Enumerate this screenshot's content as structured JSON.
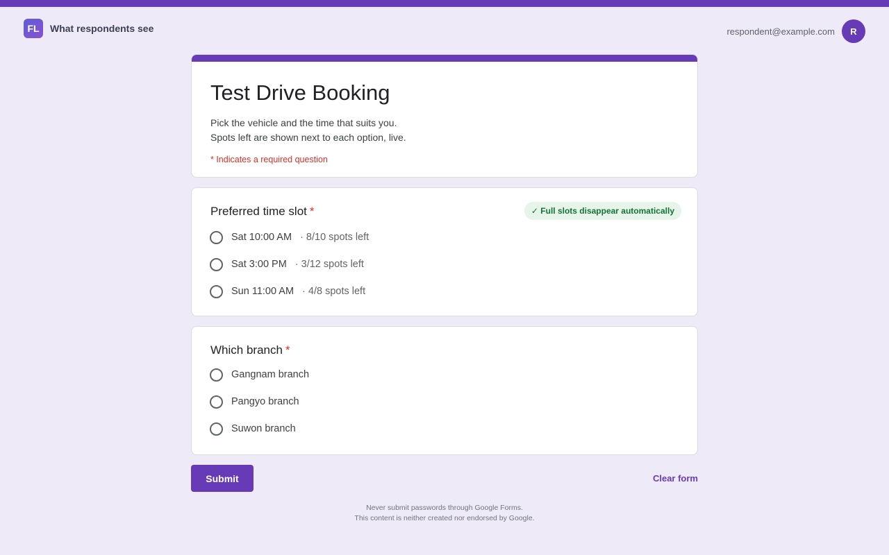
{
  "app": {
    "logo_text": "FL",
    "title": "What respondents see"
  },
  "account": {
    "email": "respondent@example.com",
    "avatar_initial": "R"
  },
  "form": {
    "title": "Test Drive Booking",
    "description_line1": "Pick the vehicle and the time that suits you.",
    "description_line2": "Spots left are shown next to each option, live.",
    "required_note": "* Indicates a required question"
  },
  "questions": [
    {
      "title": "Preferred time slot",
      "required_mark": "*",
      "badge": "✓ Full slots disappear automatically",
      "options": [
        {
          "label": "Sat 10:00 AM",
          "meta": "· 8/10 spots left"
        },
        {
          "label": "Sat 3:00 PM",
          "meta": "· 3/12 spots left"
        },
        {
          "label": "Sun 11:00 AM",
          "meta": "· 4/8 spots left"
        }
      ]
    },
    {
      "title": "Which branch",
      "required_mark": "*",
      "options": [
        {
          "label": "Gangnam branch"
        },
        {
          "label": "Pangyo branch"
        },
        {
          "label": "Suwon branch"
        }
      ]
    }
  ],
  "actions": {
    "submit_label": "Submit",
    "clear_label": "Clear form"
  },
  "footer": {
    "line1": "Never submit passwords through Google Forms.",
    "line2": "This content is neither created nor endorsed by Google."
  },
  "colors": {
    "accent": "#673ab7",
    "page_background": "#efeaf8",
    "required": "#d93025",
    "badge_text": "#137333",
    "badge_background": "#e6f4ea"
  }
}
